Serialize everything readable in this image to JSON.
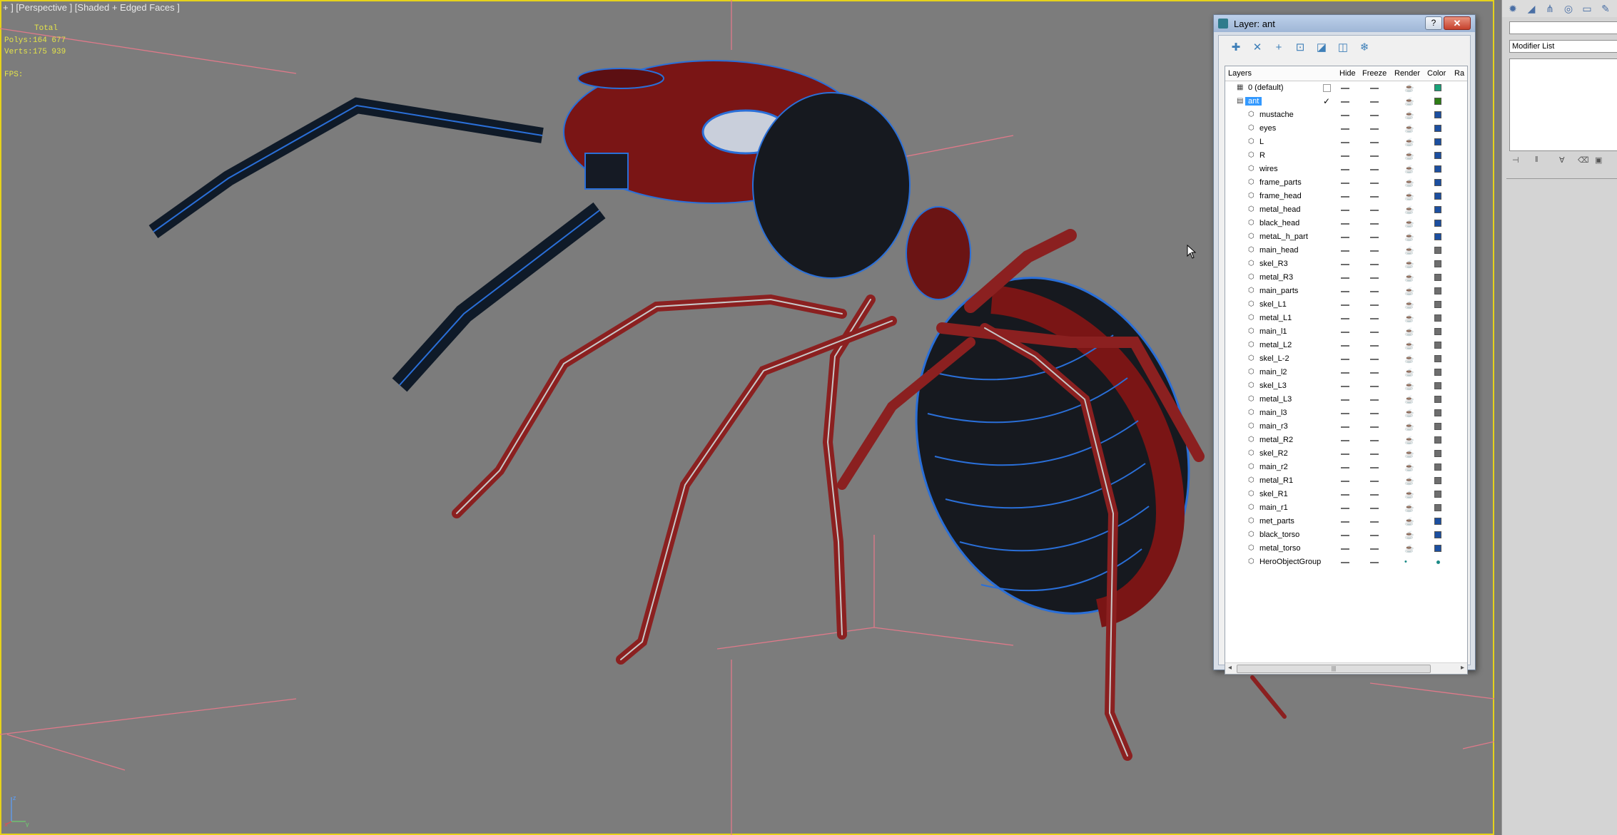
{
  "viewport": {
    "label": "+ ] [Perspective ] [Shaded + Edged Faces ]",
    "stats": {
      "header": "Total",
      "polys_label": "Polys:",
      "polys_value": "164 677",
      "verts_label": "Verts:",
      "verts_value": "175 939",
      "fps_label": "FPS:"
    },
    "axis": {
      "x": "x",
      "y": "y",
      "z": "z"
    },
    "colors": {
      "border": "#e6d21a",
      "grid": "#e07a8a",
      "stats": "#e3e34a"
    }
  },
  "layer_dialog": {
    "title": "Layer: ant",
    "help": "?",
    "close": "✕",
    "toolbar_icons": [
      "create-layer-icon",
      "delete-layer-icon",
      "add-to-layer-icon",
      "select-objects-icon",
      "highlight-icon",
      "hide-all-icon",
      "freeze-all-icon"
    ],
    "columns": {
      "layers": "Layers",
      "hide": "Hide",
      "freeze": "Freeze",
      "render": "Render",
      "color": "Color",
      "radiosity": "Ra"
    },
    "rows": [
      {
        "name": "0 (default)",
        "type": "layer",
        "color": "#1aa37a",
        "current": "",
        "indent": 0
      },
      {
        "name": "ant",
        "type": "layer-open",
        "color": "#2e7d16",
        "current": "✓",
        "indent": 0,
        "selected": true
      },
      {
        "name": "mustache",
        "type": "object",
        "color": "#1c4fa0",
        "indent": 1
      },
      {
        "name": "eyes",
        "type": "object",
        "color": "#1c4fa0",
        "indent": 1
      },
      {
        "name": "L",
        "type": "object",
        "color": "#1c4fa0",
        "indent": 1
      },
      {
        "name": "R",
        "type": "object",
        "color": "#1c4fa0",
        "indent": 1
      },
      {
        "name": "wires",
        "type": "object",
        "color": "#1c4fa0",
        "indent": 1
      },
      {
        "name": "frame_parts",
        "type": "object",
        "color": "#1c4fa0",
        "indent": 1
      },
      {
        "name": "frame_head",
        "type": "object",
        "color": "#1c4fa0",
        "indent": 1
      },
      {
        "name": "metal_head",
        "type": "object",
        "color": "#1c4fa0",
        "indent": 1
      },
      {
        "name": "black_head",
        "type": "object",
        "color": "#1c4fa0",
        "indent": 1
      },
      {
        "name": "metaL_h_part",
        "type": "object",
        "color": "#1c4fa0",
        "indent": 1
      },
      {
        "name": "main_head",
        "type": "object",
        "color": "#6e6e6e",
        "indent": 1
      },
      {
        "name": "skel_R3",
        "type": "object",
        "color": "#6e6e6e",
        "indent": 1
      },
      {
        "name": "metal_R3",
        "type": "object",
        "color": "#6e6e6e",
        "indent": 1
      },
      {
        "name": "main_parts",
        "type": "object",
        "color": "#6e6e6e",
        "indent": 1
      },
      {
        "name": "skel_L1",
        "type": "object",
        "color": "#6e6e6e",
        "indent": 1
      },
      {
        "name": "metal_L1",
        "type": "object",
        "color": "#6e6e6e",
        "indent": 1
      },
      {
        "name": "main_l1",
        "type": "object",
        "color": "#6e6e6e",
        "indent": 1
      },
      {
        "name": "metal_L2",
        "type": "object",
        "color": "#6e6e6e",
        "indent": 1
      },
      {
        "name": "skel_L-2",
        "type": "object",
        "color": "#6e6e6e",
        "indent": 1
      },
      {
        "name": "main_l2",
        "type": "object",
        "color": "#6e6e6e",
        "indent": 1
      },
      {
        "name": "skel_L3",
        "type": "object",
        "color": "#6e6e6e",
        "indent": 1
      },
      {
        "name": "metal_L3",
        "type": "object",
        "color": "#6e6e6e",
        "indent": 1
      },
      {
        "name": "main_l3",
        "type": "object",
        "color": "#6e6e6e",
        "indent": 1
      },
      {
        "name": "main_r3",
        "type": "object",
        "color": "#6e6e6e",
        "indent": 1
      },
      {
        "name": "metal_R2",
        "type": "object",
        "color": "#6e6e6e",
        "indent": 1
      },
      {
        "name": "skel_R2",
        "type": "object",
        "color": "#6e6e6e",
        "indent": 1
      },
      {
        "name": "main_r2",
        "type": "object",
        "color": "#6e6e6e",
        "indent": 1
      },
      {
        "name": "metal_R1",
        "type": "object",
        "color": "#6e6e6e",
        "indent": 1
      },
      {
        "name": "skel_R1",
        "type": "object",
        "color": "#6e6e6e",
        "indent": 1
      },
      {
        "name": "main_r1",
        "type": "object",
        "color": "#6e6e6e",
        "indent": 1
      },
      {
        "name": "met_parts",
        "type": "object",
        "color": "#1c4fa0",
        "indent": 1
      },
      {
        "name": "black_torso",
        "type": "object",
        "color": "#1c4fa0",
        "indent": 1
      },
      {
        "name": "metal_torso",
        "type": "object",
        "color": "#1c4fa0",
        "indent": 1
      },
      {
        "name": "HeroObjectGroup",
        "type": "object",
        "color": "#1a8a86",
        "indent": 1,
        "dot": true
      }
    ],
    "scroll_grip": "|||"
  },
  "command_panel": {
    "tabs": [
      "create-tab-icon",
      "modify-tab-icon",
      "hierarchy-tab-icon",
      "motion-tab-icon",
      "display-tab-icon",
      "utilities-tab-icon"
    ],
    "name_value": "",
    "modifier_list": "Modifier List"
  }
}
